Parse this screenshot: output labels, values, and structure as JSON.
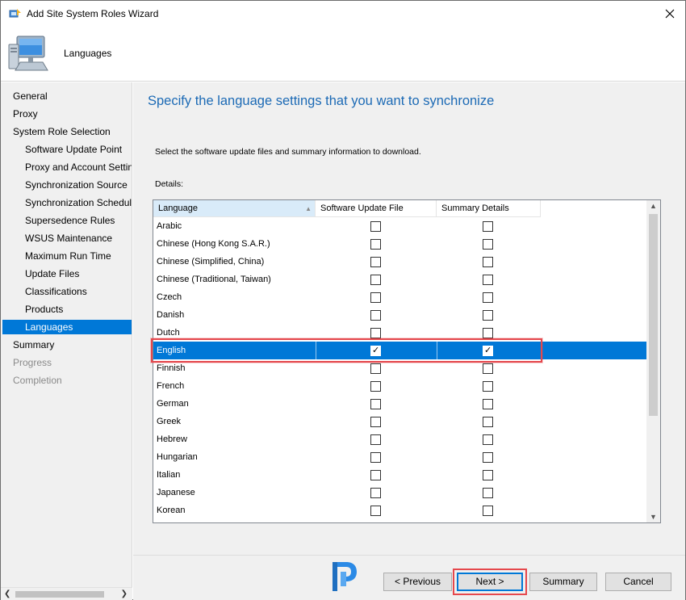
{
  "window": {
    "title": "Add Site System Roles Wizard"
  },
  "header": {
    "page_name": "Languages"
  },
  "nav": {
    "items": [
      {
        "label": "General",
        "level": 1,
        "state": "normal"
      },
      {
        "label": "Proxy",
        "level": 1,
        "state": "normal"
      },
      {
        "label": "System Role Selection",
        "level": 1,
        "state": "normal"
      },
      {
        "label": "Software Update Point",
        "level": 2,
        "state": "normal"
      },
      {
        "label": "Proxy and Account Settin",
        "level": 2,
        "state": "normal"
      },
      {
        "label": "Synchronization Source",
        "level": 2,
        "state": "normal"
      },
      {
        "label": "Synchronization Schedule",
        "level": 2,
        "state": "normal"
      },
      {
        "label": "Supersedence Rules",
        "level": 2,
        "state": "normal"
      },
      {
        "label": "WSUS Maintenance",
        "level": 2,
        "state": "normal"
      },
      {
        "label": "Maximum Run Time",
        "level": 2,
        "state": "normal"
      },
      {
        "label": "Update Files",
        "level": 2,
        "state": "normal"
      },
      {
        "label": "Classifications",
        "level": 2,
        "state": "normal"
      },
      {
        "label": "Products",
        "level": 2,
        "state": "normal"
      },
      {
        "label": "Languages",
        "level": 2,
        "state": "selected"
      },
      {
        "label": "Summary",
        "level": 1,
        "state": "normal"
      },
      {
        "label": "Progress",
        "level": 1,
        "state": "disabled"
      },
      {
        "label": "Completion",
        "level": 1,
        "state": "disabled"
      }
    ]
  },
  "content": {
    "heading": "Specify the language settings that you want to synchronize",
    "instruction": "Select the software update files and summary information to download.",
    "details_label": "Details:"
  },
  "grid": {
    "columns": [
      "Language",
      "Software Update File",
      "Summary Details"
    ],
    "rows": [
      {
        "language": "Arabic",
        "update_file": false,
        "summary": false
      },
      {
        "language": "Chinese (Hong Kong S.A.R.)",
        "update_file": false,
        "summary": false
      },
      {
        "language": "Chinese (Simplified, China)",
        "update_file": false,
        "summary": false
      },
      {
        "language": "Chinese (Traditional, Taiwan)",
        "update_file": false,
        "summary": false
      },
      {
        "language": "Czech",
        "update_file": false,
        "summary": false
      },
      {
        "language": "Danish",
        "update_file": false,
        "summary": false
      },
      {
        "language": "Dutch",
        "update_file": false,
        "summary": false
      },
      {
        "language": "English",
        "update_file": true,
        "summary": true,
        "selected": true
      },
      {
        "language": "Finnish",
        "update_file": false,
        "summary": false
      },
      {
        "language": "French",
        "update_file": false,
        "summary": false
      },
      {
        "language": "German",
        "update_file": false,
        "summary": false
      },
      {
        "language": "Greek",
        "update_file": false,
        "summary": false
      },
      {
        "language": "Hebrew",
        "update_file": false,
        "summary": false
      },
      {
        "language": "Hungarian",
        "update_file": false,
        "summary": false
      },
      {
        "language": "Italian",
        "update_file": false,
        "summary": false
      },
      {
        "language": "Japanese",
        "update_file": false,
        "summary": false
      },
      {
        "language": "Korean",
        "update_file": false,
        "summary": false
      }
    ]
  },
  "buttons": {
    "previous": "< Previous",
    "next": "Next >",
    "summary": "Summary",
    "cancel": "Cancel"
  },
  "colors": {
    "accent": "#0078d7",
    "heading": "#1c6ab5",
    "annotation": "#e5484d"
  }
}
